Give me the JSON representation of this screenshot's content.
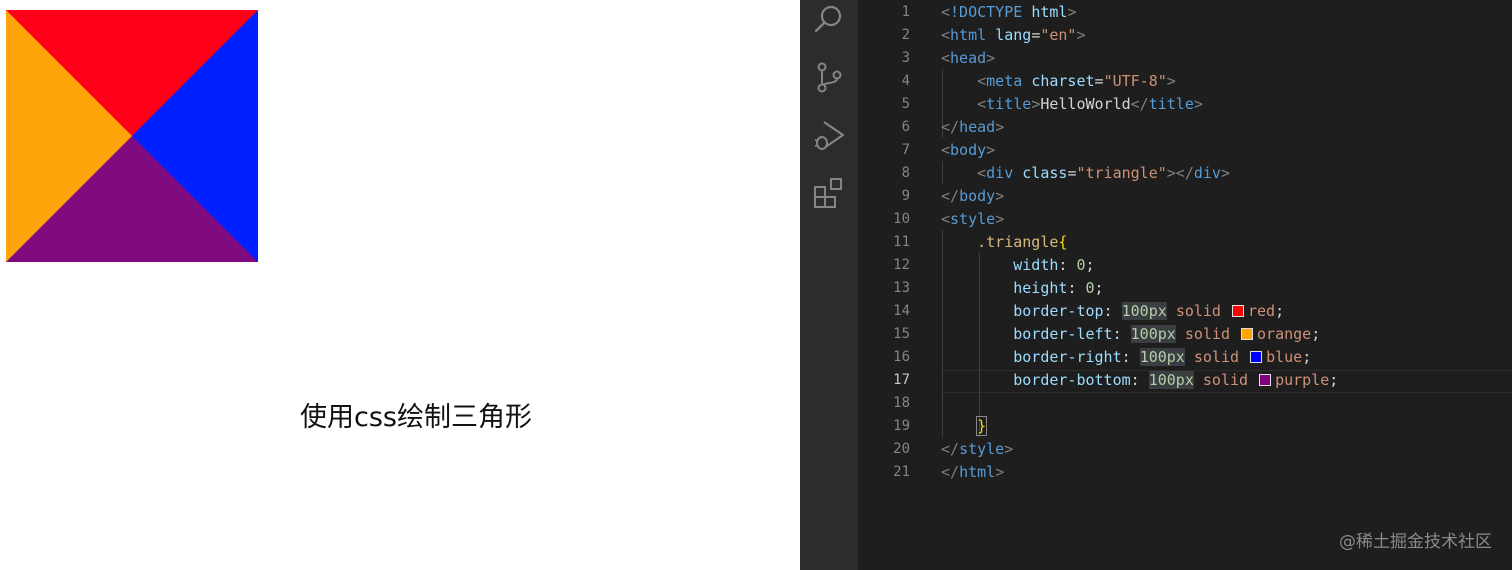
{
  "preview": {
    "caption": "使用css绘制三角形",
    "colors": {
      "top": "#ff0019",
      "left": "#ffa40b",
      "right": "#0020ff",
      "bottom": "#800b80"
    }
  },
  "activity_bar": {
    "icons": [
      "search-icon",
      "source-control-icon",
      "run-debug-icon",
      "extensions-icon"
    ]
  },
  "editor": {
    "active_line": 17,
    "line_numbers": [
      "1",
      "2",
      "3",
      "4",
      "5",
      "6",
      "7",
      "8",
      "9",
      "10",
      "11",
      "12",
      "13",
      "14",
      "15",
      "16",
      "17",
      "18",
      "19",
      "20",
      "21"
    ],
    "code": {
      "l1_doctype": "!DOCTYPE",
      "l1_html": "html",
      "l2_tag": "html",
      "l2_attr": "lang",
      "l2_val": "\"en\"",
      "l3_tag": "head",
      "l4_tag": "meta",
      "l4_attr": "charset",
      "l4_val": "\"UTF-8\"",
      "l5_tag": "title",
      "l5_text": "HelloWorld",
      "l5_close": "title",
      "l6_tag": "head",
      "l7_tag": "body",
      "l8_tag": "div",
      "l8_attr": "class",
      "l8_val": "\"triangle\"",
      "l8_close": "div",
      "l9_tag": "body",
      "l10_tag": "style",
      "l11_selector": ".triangle",
      "l12_prop": "width",
      "l12_val": "0",
      "l13_prop": "height",
      "l13_val": "0",
      "l14_prop": "border-top",
      "l14_num": "100px",
      "l14_style": "solid",
      "l14_color": "red",
      "l15_prop": "border-left",
      "l15_num": "100px",
      "l15_style": "solid",
      "l15_color": "orange",
      "l16_prop": "border-right",
      "l16_num": "100px",
      "l16_style": "solid",
      "l16_color": "blue",
      "l17_prop": "border-bottom",
      "l17_num": "100px",
      "l17_style": "solid",
      "l17_color": "purple",
      "l20_tag": "style",
      "l21_tag": "html"
    },
    "swatch_colors": {
      "red": "#ff0000",
      "orange": "#ffa500",
      "blue": "#0000ff",
      "purple": "#800080"
    }
  },
  "watermark": "@稀土掘金技术社区"
}
